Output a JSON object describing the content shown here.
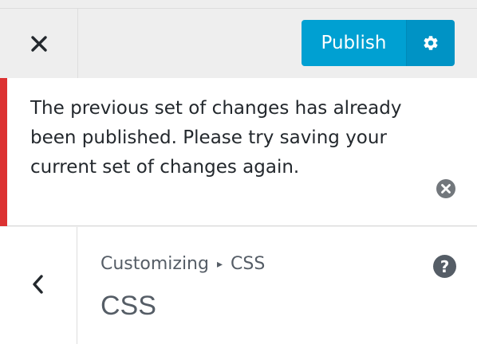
{
  "header": {
    "close_icon": "close-icon",
    "publish_label": "Publish",
    "settings_icon": "gear-icon"
  },
  "notice": {
    "type": "error",
    "message": "The previous set of changes has already been published. Please try saving your current set of changes again.",
    "dismiss_icon": "dismiss-circle-x-icon"
  },
  "section": {
    "back_icon": "chevron-left-icon",
    "breadcrumb_root": "Customizing",
    "breadcrumb_separator": "▸",
    "breadcrumb_current": "CSS",
    "title": "CSS",
    "help_icon": "help-question-icon",
    "help_glyph": "?"
  },
  "colors": {
    "accent": "#00a0d2",
    "accent_dark": "#0093c5",
    "error": "#dc3232",
    "text": "#23282d",
    "muted_text": "#555d66",
    "panel_bg": "#eeeeee"
  }
}
